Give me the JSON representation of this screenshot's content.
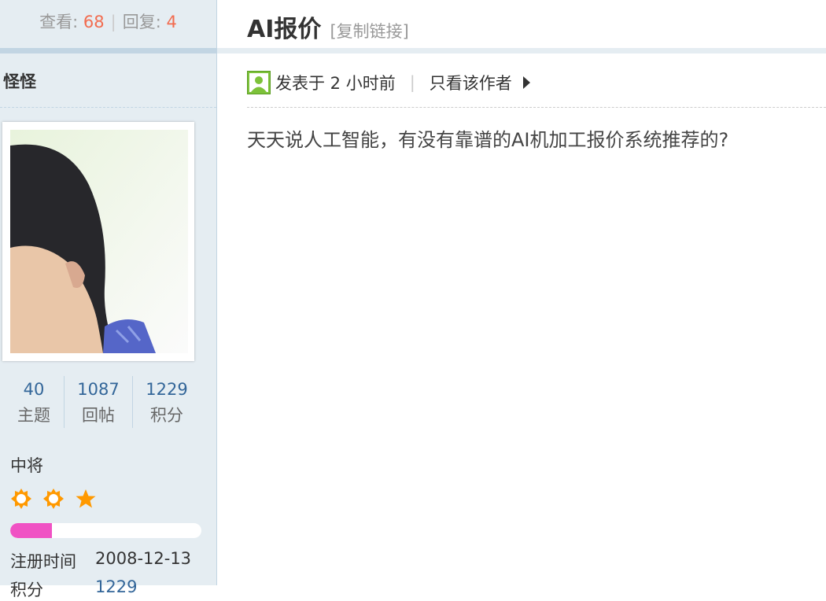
{
  "thread": {
    "views_label": "查看:",
    "views": "68",
    "separator": "|",
    "replies_label": "回复:",
    "replies": "4",
    "title": "AI报价",
    "copy_link": "[复制链接]"
  },
  "author": {
    "name": "怪怪",
    "stats": [
      {
        "value": "40",
        "label": "主题"
      },
      {
        "value": "1087",
        "label": "回帖"
      },
      {
        "value": "1229",
        "label": "积分"
      }
    ],
    "rank": "中将",
    "star_icons": [
      "sun-icon",
      "sun-icon",
      "star-icon"
    ],
    "level_progress": 0.22,
    "register_label": "注册时间",
    "register_date": "2008-12-13",
    "points_label": "积分",
    "points_value": "1229"
  },
  "post": {
    "posted_label": "发表于 2 小时前",
    "separator": "|",
    "only_author": "只看该作者",
    "content": "天天说人工智能，有没有靠谱的AI机加工报价系统推荐的?"
  },
  "colors": {
    "accent_number": "#f26c4f",
    "link_blue": "#336699",
    "sidebar_bg": "#e5edf2",
    "star_orange": "#f90",
    "progress_pink": "#f052c4"
  }
}
